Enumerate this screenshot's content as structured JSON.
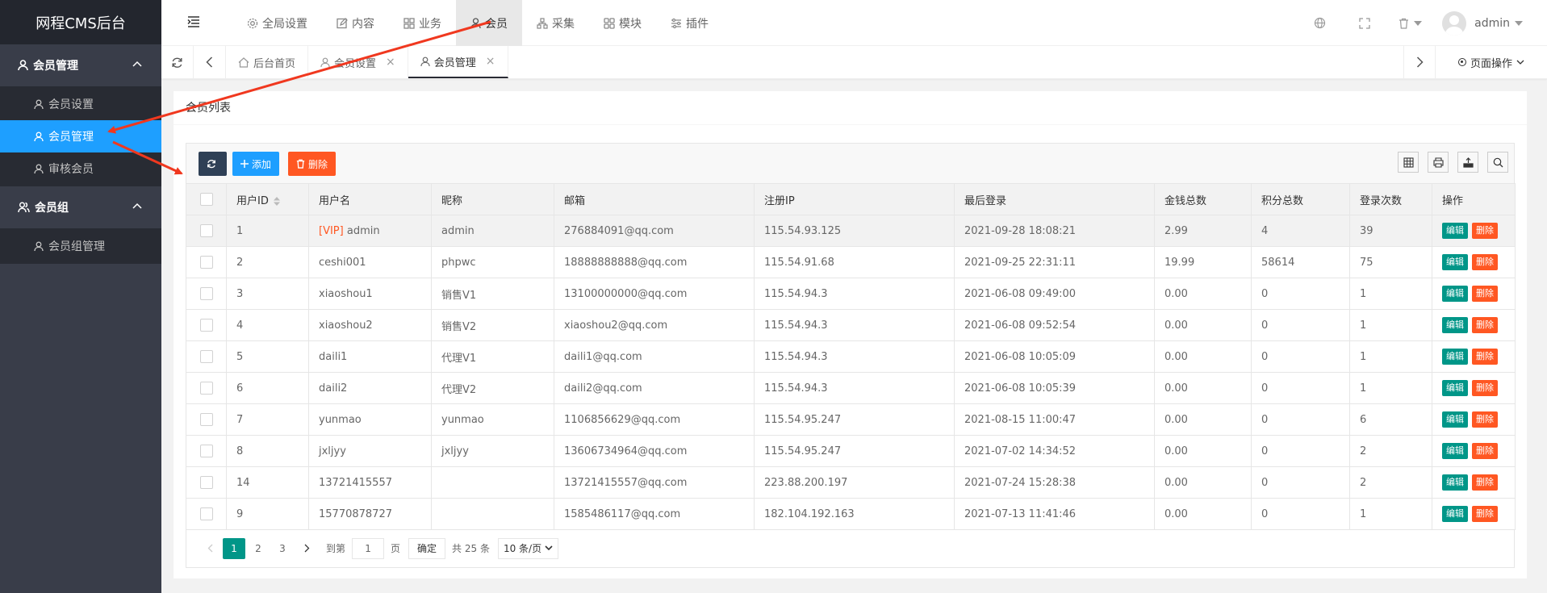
{
  "app": {
    "title": "网程CMS后台"
  },
  "sidebar": {
    "groups": [
      {
        "label": "会员管理",
        "items": [
          {
            "label": "会员设置",
            "active": false
          },
          {
            "label": "会员管理",
            "active": true
          },
          {
            "label": "审核会员",
            "active": false
          }
        ]
      },
      {
        "label": "会员组",
        "items": [
          {
            "label": "会员组管理",
            "active": false
          }
        ]
      }
    ]
  },
  "topnav": {
    "items": [
      {
        "label": "全局设置",
        "icon": "gear-icon"
      },
      {
        "label": "内容",
        "icon": "edit-icon"
      },
      {
        "label": "业务",
        "icon": "grid-icon"
      },
      {
        "label": "会员",
        "icon": "user-icon",
        "active": true
      },
      {
        "label": "采集",
        "icon": "sitemap-icon"
      },
      {
        "label": "模块",
        "icon": "apps-icon"
      },
      {
        "label": "插件",
        "icon": "slider-icon"
      }
    ],
    "user": "admin"
  },
  "tabs": {
    "items": [
      {
        "label": "后台首页",
        "closable": false
      },
      {
        "label": "会员设置",
        "closable": true
      },
      {
        "label": "会员管理",
        "closable": true,
        "active": true
      }
    ],
    "close_glyph": "×",
    "page_ops": "页面操作"
  },
  "panel": {
    "title": "会员列表",
    "add_label": "添加",
    "delete_label": "删除"
  },
  "table": {
    "columns": [
      "用户ID",
      "用户名",
      "昵称",
      "邮箱",
      "注册IP",
      "最后登录",
      "金钱总数",
      "积分总数",
      "登录次数",
      "操作"
    ],
    "vip_tag": "[VIP]",
    "edit_label": "编辑",
    "delete_label": "删除",
    "rows": [
      {
        "id": "1",
        "vip": true,
        "username": "admin",
        "nickname": "admin",
        "email": "276884091@qq.com",
        "ip": "115.54.93.125",
        "last_login": "2021-09-28 18:08:21",
        "money": "2.99",
        "points": "4",
        "logins": "39"
      },
      {
        "id": "2",
        "vip": false,
        "username": "ceshi001",
        "nickname": "phpwc",
        "email": "18888888888@qq.com",
        "ip": "115.54.91.68",
        "last_login": "2021-09-25 22:31:11",
        "money": "19.99",
        "points": "58614",
        "logins": "75"
      },
      {
        "id": "3",
        "vip": false,
        "username": "xiaoshou1",
        "nickname": "销售V1",
        "email": "13100000000@qq.com",
        "ip": "115.54.94.3",
        "last_login": "2021-06-08 09:49:00",
        "money": "0.00",
        "points": "0",
        "logins": "1"
      },
      {
        "id": "4",
        "vip": false,
        "username": "xiaoshou2",
        "nickname": "销售V2",
        "email": "xiaoshou2@qq.com",
        "ip": "115.54.94.3",
        "last_login": "2021-06-08 09:52:54",
        "money": "0.00",
        "points": "0",
        "logins": "1"
      },
      {
        "id": "5",
        "vip": false,
        "username": "daili1",
        "nickname": "代理V1",
        "email": "daili1@qq.com",
        "ip": "115.54.94.3",
        "last_login": "2021-06-08 10:05:09",
        "money": "0.00",
        "points": "0",
        "logins": "1"
      },
      {
        "id": "6",
        "vip": false,
        "username": "daili2",
        "nickname": "代理V2",
        "email": "daili2@qq.com",
        "ip": "115.54.94.3",
        "last_login": "2021-06-08 10:05:39",
        "money": "0.00",
        "points": "0",
        "logins": "1"
      },
      {
        "id": "7",
        "vip": false,
        "username": "yunmao",
        "nickname": "yunmao",
        "email": "1106856629@qq.com",
        "ip": "115.54.95.247",
        "last_login": "2021-08-15 11:00:47",
        "money": "0.00",
        "points": "0",
        "logins": "6"
      },
      {
        "id": "8",
        "vip": false,
        "username": "jxljyy",
        "nickname": "jxljyy",
        "email": "13606734964@qq.com",
        "ip": "115.54.95.247",
        "last_login": "2021-07-02 14:34:52",
        "money": "0.00",
        "points": "0",
        "logins": "2"
      },
      {
        "id": "14",
        "vip": false,
        "username": "13721415557",
        "nickname": "",
        "email": "13721415557@qq.com",
        "ip": "223.88.200.197",
        "last_login": "2021-07-24 15:28:38",
        "money": "0.00",
        "points": "0",
        "logins": "2"
      },
      {
        "id": "9",
        "vip": false,
        "username": "15770878727",
        "nickname": "",
        "email": "1585486117@qq.com",
        "ip": "182.104.192.163",
        "last_login": "2021-07-13 11:41:46",
        "money": "0.00",
        "points": "0",
        "logins": "1"
      }
    ]
  },
  "pager": {
    "pages": [
      "1",
      "2",
      "3"
    ],
    "current": "1",
    "goto_label": "到第",
    "goto_value": "1",
    "page_unit": "页",
    "confirm_label": "确定",
    "total_label": "共 25 条",
    "per_page": "10 条/页"
  },
  "colors": {
    "accent": "#1e9fff",
    "edit": "#009688",
    "danger": "#ff5722",
    "sidebar": "#393d49",
    "annotation": "#f0381f"
  }
}
